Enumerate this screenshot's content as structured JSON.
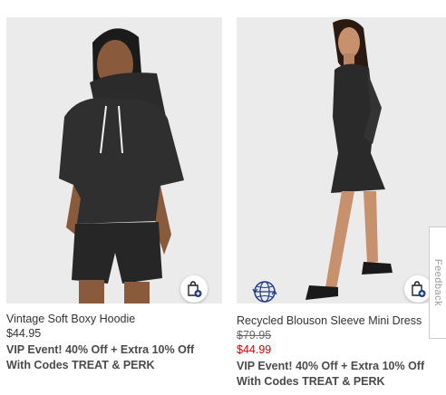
{
  "products": [
    {
      "name": "Vintage Soft Boxy Hoodie",
      "price": "$44.95",
      "promo_line1": "VIP Event! 40% Off + Extra 10% Off",
      "promo_line2": "With Codes TREAT & PERK",
      "image_icon": "product-photo-hoodie"
    },
    {
      "name": "Recycled Blouson Sleeve Mini Dress",
      "original_price": "$79.95",
      "sale_price": "$44.99",
      "promo_line1": "VIP Event! 40% Off + Extra 10% Off",
      "promo_line2": "With Codes TREAT & PERK",
      "badge_icon": "globe-recycled-icon",
      "image_icon": "product-photo-dress"
    }
  ],
  "feedback_tab": {
    "label": "Feedback"
  },
  "colors": {
    "sale_price": "#d00000",
    "badge": "#1f3a8a",
    "photo_bg": "#ebebeb"
  }
}
